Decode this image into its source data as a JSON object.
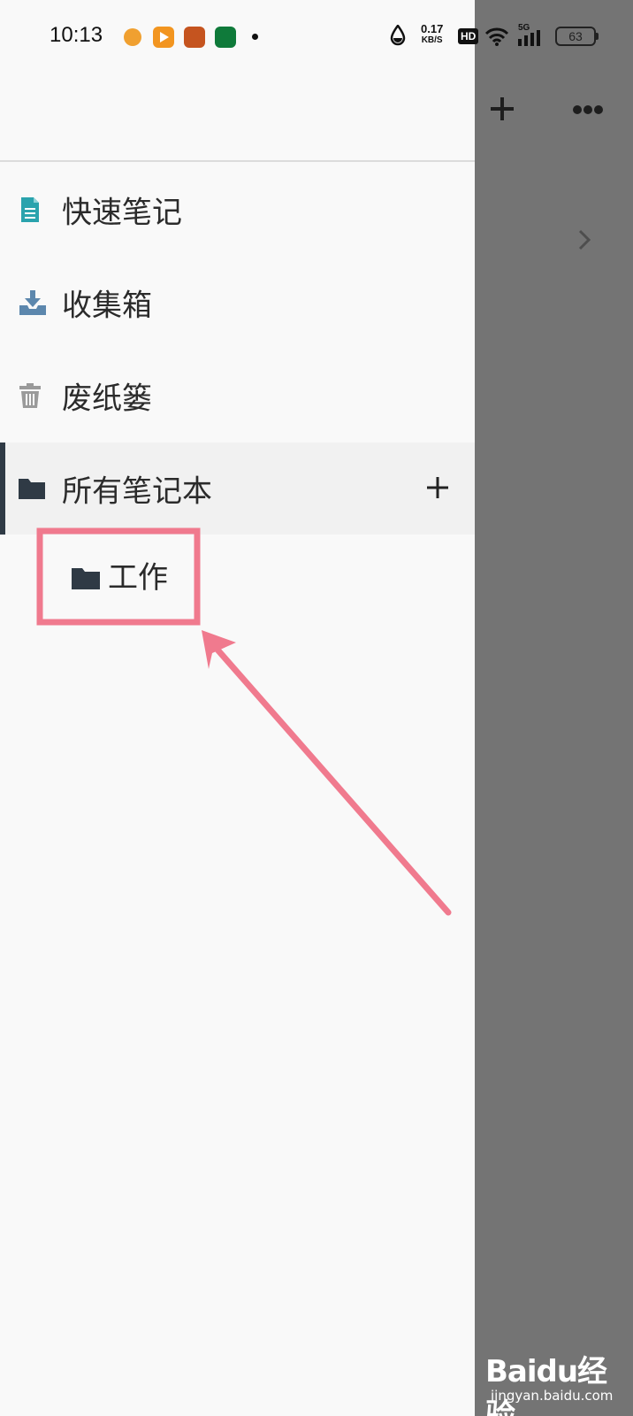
{
  "status_bar": {
    "time": "10:13",
    "net_speed_value": "0.17",
    "net_speed_unit": "KB/S",
    "hd_badge": "HD",
    "network_type": "5G",
    "battery": "63"
  },
  "drawer": {
    "items": [
      {
        "label": "快速笔记",
        "icon": "note-icon"
      },
      {
        "label": "收集箱",
        "icon": "inbox-download-icon"
      },
      {
        "label": "废纸篓",
        "icon": "trash-icon"
      },
      {
        "label": "所有笔记本",
        "icon": "folder-icon"
      }
    ],
    "notebooks": [
      {
        "label": "工作",
        "icon": "folder-icon"
      }
    ]
  },
  "watermark": {
    "logo": "Baidu经验",
    "url": "jingyan.baidu.com"
  },
  "colors": {
    "accent_teal": "#2aa3ad",
    "inbox_blue": "#5c87ad",
    "annotation_pink": "#f07a8e",
    "overlay_gray": "#747474"
  }
}
